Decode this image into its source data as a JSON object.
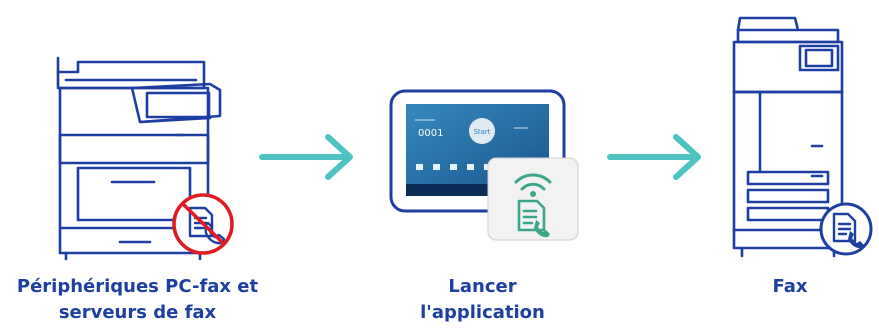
{
  "steps": [
    {
      "label_line1": "Périphériques PC-fax et",
      "label_line2": "serveurs de fax"
    },
    {
      "label_line1": "Lancer",
      "label_line2": "l'application"
    },
    {
      "label_line1": "Fax"
    }
  ],
  "tablet_screen": {
    "counter": "0001",
    "start": "Start"
  },
  "colors": {
    "device_stroke": "#1d3fa2",
    "arrow": "#4ec3c2",
    "prohibited": "#e11b22",
    "fax_icon_green": "#3aa68a",
    "caption_text": "#1d3fa2"
  },
  "icons": [
    "printer-icon",
    "no-fax-icon",
    "arrow-right-icon",
    "tablet-icon",
    "fax-app-icon",
    "copier-icon",
    "fax-phone-icon"
  ]
}
